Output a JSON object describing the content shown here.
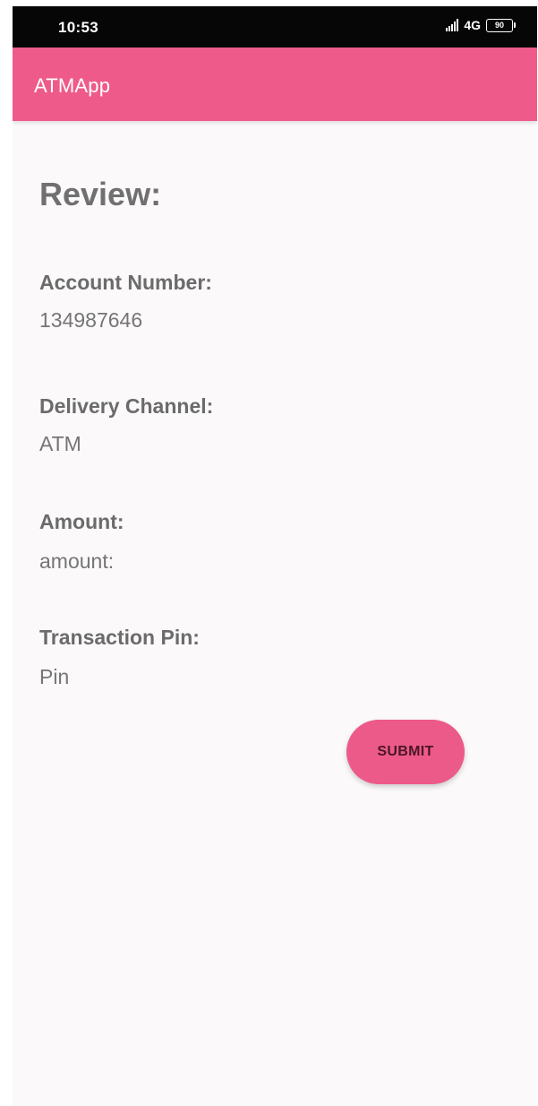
{
  "status_bar": {
    "time": "10:53",
    "network": "4G",
    "battery": "90",
    "icons": [
      "signal-icon",
      "battery-icon"
    ]
  },
  "app_bar": {
    "title": "ATMApp",
    "color": "#ee5b8a"
  },
  "review": {
    "heading": "Review:",
    "fields": [
      {
        "label": "Account Number:",
        "value": "134987646"
      },
      {
        "label": "Delivery Channel:",
        "value": "ATM"
      },
      {
        "label": "Amount:",
        "value": "amount:"
      },
      {
        "label": "Transaction Pin:",
        "value": "Pin"
      }
    ]
  },
  "actions": {
    "submit_label": "SUBMIT",
    "accent_color": "#ec5a89"
  }
}
